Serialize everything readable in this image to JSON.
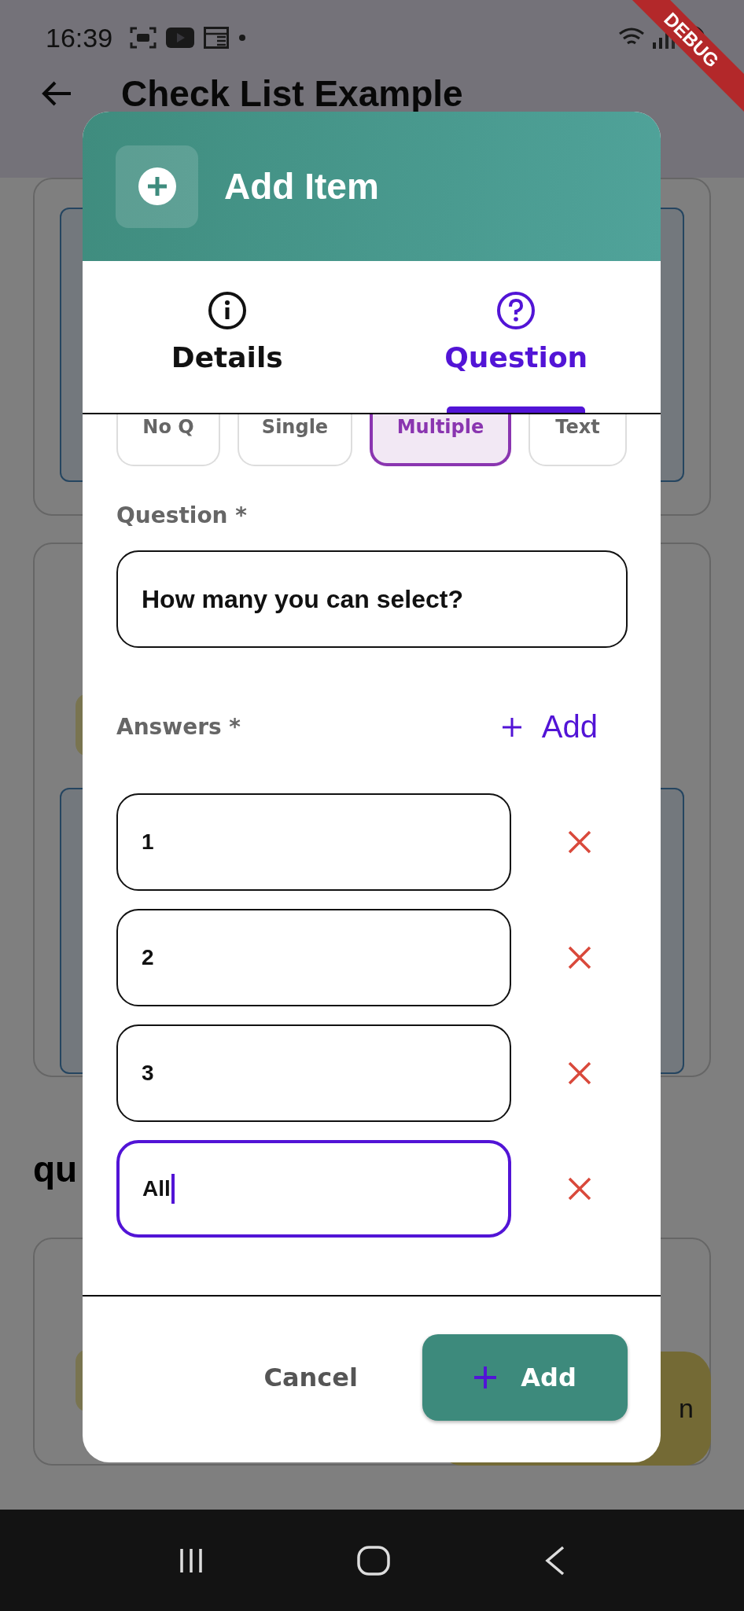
{
  "status_bar": {
    "time": "16:39"
  },
  "debug_banner": {
    "label": "DEBUG"
  },
  "app_bar": {
    "title": "Check List Example"
  },
  "background": {
    "section_heading": "qu",
    "fab_label": "n"
  },
  "dialog": {
    "title": "Add Item",
    "tabs": [
      {
        "label": "Details",
        "selected": false
      },
      {
        "label": "Question",
        "selected": true
      }
    ],
    "question_types": [
      {
        "label": "No Q",
        "selected": false
      },
      {
        "label": "Single",
        "selected": false
      },
      {
        "label": "Multiple",
        "selected": true
      },
      {
        "label": "Text",
        "selected": false
      }
    ],
    "question_label": "Question *",
    "question_value": "How many you can select?",
    "answers_label": "Answers *",
    "add_answer_label": "Add",
    "answers": [
      {
        "value": "1",
        "focused": false
      },
      {
        "value": "2",
        "focused": false
      },
      {
        "value": "3",
        "focused": false
      },
      {
        "value": "All",
        "focused": true
      }
    ],
    "cancel_label": "Cancel",
    "add_label": "Add"
  }
}
